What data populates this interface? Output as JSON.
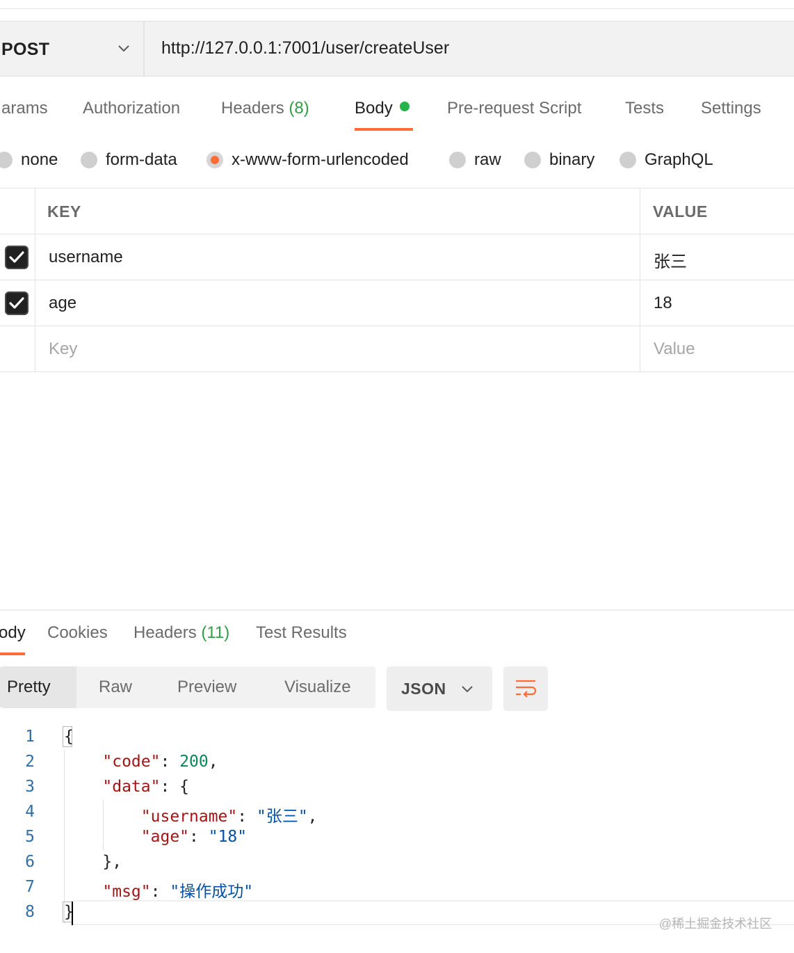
{
  "request": {
    "method": "POST",
    "url": "http://127.0.0.1:7001/user/createUser"
  },
  "request_tabs": [
    {
      "label": "arams"
    },
    {
      "label": "Authorization"
    },
    {
      "label": "Headers",
      "count": "(8)"
    },
    {
      "label": "Body",
      "active": true
    },
    {
      "label": "Pre-request Script"
    },
    {
      "label": "Tests"
    },
    {
      "label": "Settings"
    }
  ],
  "body_types": [
    {
      "label": "none"
    },
    {
      "label": "form-data"
    },
    {
      "label": "x-www-form-urlencoded",
      "selected": true
    },
    {
      "label": "raw"
    },
    {
      "label": "binary"
    },
    {
      "label": "GraphQL"
    }
  ],
  "params_table": {
    "headers": {
      "key": "KEY",
      "value": "VALUE"
    },
    "rows": [
      {
        "checked": true,
        "key": "username",
        "value": "张三"
      },
      {
        "checked": true,
        "key": "age",
        "value": "18"
      }
    ],
    "placeholder": {
      "key": "Key",
      "value": "Value"
    }
  },
  "response_tabs": [
    {
      "label": "ody",
      "active": true
    },
    {
      "label": "Cookies"
    },
    {
      "label": "Headers",
      "count": "(11)"
    },
    {
      "label": "Test Results"
    }
  ],
  "view_modes": [
    "Pretty",
    "Raw",
    "Preview",
    "Visualize"
  ],
  "format": "JSON",
  "response_body": {
    "line_numbers": [
      "1",
      "2",
      "3",
      "4",
      "5",
      "6",
      "7",
      "8"
    ],
    "tokens": {
      "open_brace": "{",
      "code_key": "\"code\"",
      "code_value": "200",
      "data_key": "\"data\"",
      "username_key": "\"username\"",
      "username_value": "\"张三\"",
      "age_key": "\"age\"",
      "age_value": "\"18\"",
      "inner_close": "},",
      "msg_key": "\"msg\"",
      "msg_value": "\"操作成功\"",
      "close_brace": "}"
    }
  },
  "watermark": "@稀土掘金技术社区",
  "colors": {
    "accent": "#ff6c37",
    "status_dot": "#26b34a",
    "json_key": "#a31515",
    "json_number": "#098658",
    "json_string": "#0451a5"
  }
}
